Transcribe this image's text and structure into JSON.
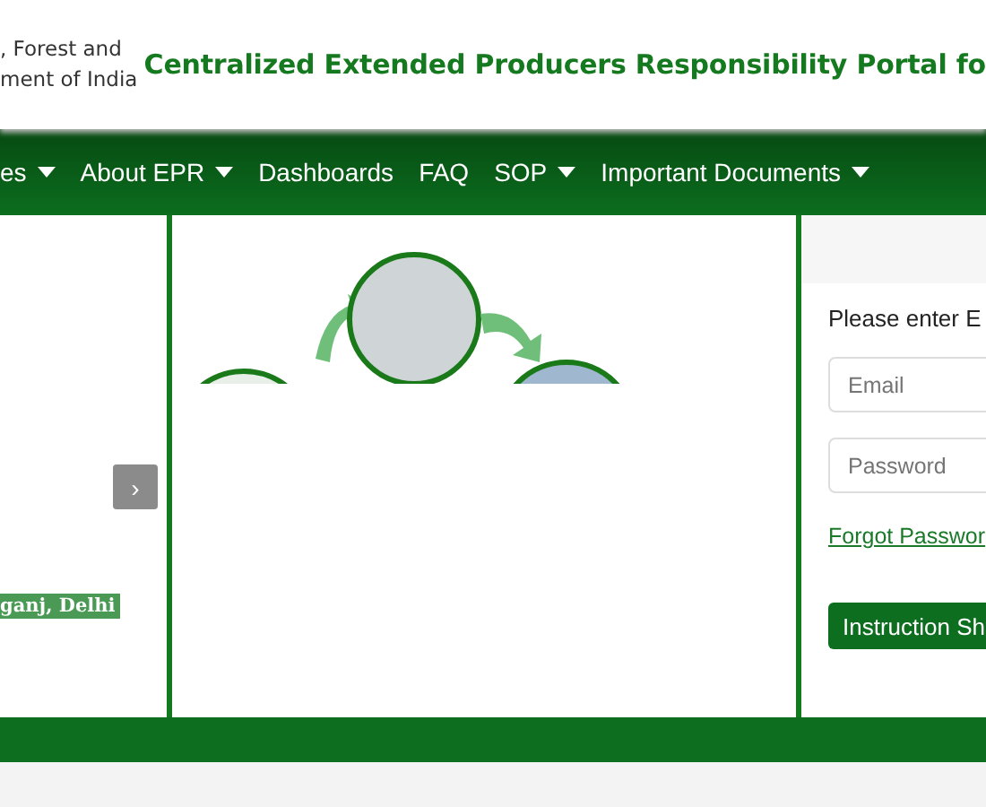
{
  "header": {
    "ministry_lines": [
      ", Forest and",
      "ment of India"
    ],
    "title": "Centralized Extended Producers Responsibility Portal fo"
  },
  "nav": {
    "items": [
      {
        "label": "es",
        "dropdown": true
      },
      {
        "label": "About EPR",
        "dropdown": true
      },
      {
        "label": "Dashboards",
        "dropdown": false
      },
      {
        "label": "FAQ",
        "dropdown": false
      },
      {
        "label": "SOP",
        "dropdown": true
      },
      {
        "label": "Important Documents",
        "dropdown": true
      }
    ]
  },
  "carousel": {
    "next": "›",
    "caption": "ganj, Delhi"
  },
  "login": {
    "prompt": "Please enter E",
    "email": {
      "placeholder": "Email"
    },
    "password": {
      "placeholder": "Password"
    },
    "forgot_link": "Forgot Passwor",
    "instruction_button": "Instruction Sh"
  }
}
